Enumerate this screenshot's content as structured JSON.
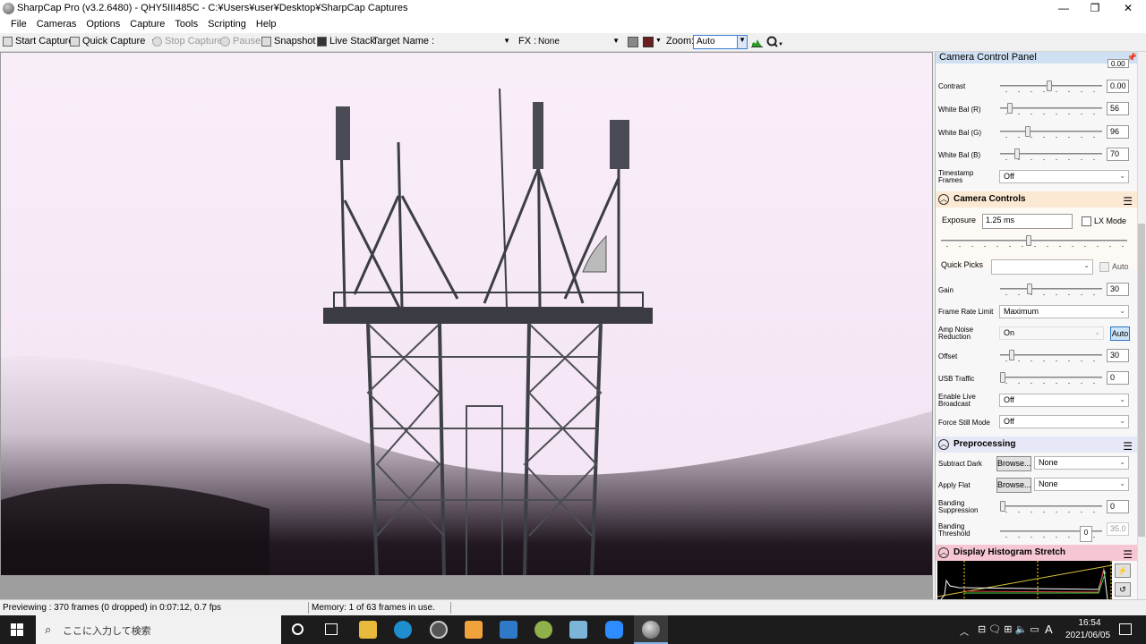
{
  "window": {
    "title": "SharpCap Pro (v3.2.6480) - QHY5III485C - C:¥Users¥user¥Desktop¥SharpCap Captures",
    "minimize": "—",
    "maximize": "❐",
    "close": "✕"
  },
  "menu": [
    "File",
    "Cameras",
    "Options",
    "Capture",
    "Tools",
    "Scripting",
    "Help"
  ],
  "toolbar": {
    "start_capture": "Start Capture",
    "quick_capture": "Quick Capture",
    "stop_capture": "Stop Capture",
    "pause": "Pause",
    "snapshot": "Snapshot",
    "live_stack": "Live Stack",
    "target_name_label": "Target Name :",
    "target_name_value": "",
    "fx_label": "FX :",
    "fx_value": "None",
    "zoom_label": "Zoom:",
    "zoom_value": "Auto"
  },
  "panel": {
    "header": "Camera Control Panel",
    "top_partial_value": "0.00",
    "contrast": {
      "label": "Contrast",
      "value": "0.00"
    },
    "wb_r": {
      "label": "White Bal (R)",
      "value": "56"
    },
    "wb_g": {
      "label": "White Bal (G)",
      "value": "96"
    },
    "wb_b": {
      "label": "White Bal (B)",
      "value": "70"
    },
    "timestamp": {
      "label1": "Timestamp",
      "label2": "Frames",
      "value": "Off"
    },
    "camera_controls": {
      "title": "Camera Controls",
      "exposure_label": "Exposure",
      "exposure_value": "1.25 ms",
      "lx_mode": "LX Mode",
      "quick_picks": "Quick Picks",
      "auto": "Auto"
    },
    "gain": {
      "label": "Gain",
      "value": "30"
    },
    "frame_rate": {
      "label": "Frame Rate Limit",
      "value": "Maximum"
    },
    "amp_noise": {
      "label1": "Amp Noise",
      "label2": "Reduction",
      "value": "On",
      "auto": "Auto"
    },
    "offset": {
      "label": "Offset",
      "value": "30"
    },
    "usb": {
      "label": "USB Traffic",
      "value": "0"
    },
    "live_broadcast": {
      "label1": "Enable Live",
      "label2": "Broadcast",
      "value": "Off"
    },
    "force_still": {
      "label": "Force Still Mode",
      "value": "Off"
    },
    "preprocessing": {
      "title": "Preprocessing",
      "subtract_dark": "Subtract Dark",
      "apply_flat": "Apply Flat",
      "browse": "Browse...",
      "none": "None",
      "banding_supp1": "Banding",
      "banding_supp2": "Suppression",
      "banding_supp_value": "0",
      "banding_thr1": "Banding",
      "banding_thr2": "Threshold",
      "banding_thr_thumb": "0",
      "banding_thr_value": "35.0"
    },
    "histogram": {
      "title": "Display Histogram Stretch"
    }
  },
  "status": {
    "previewing": "Previewing : 370 frames (0 dropped) in 0:07:12, 0.7 fps",
    "memory": "Memory: 1 of 63 frames in use."
  },
  "taskbar": {
    "search_placeholder": "ここに入力して検索",
    "time": "16:54",
    "date": "2021/06/05",
    "ime": "A"
  }
}
